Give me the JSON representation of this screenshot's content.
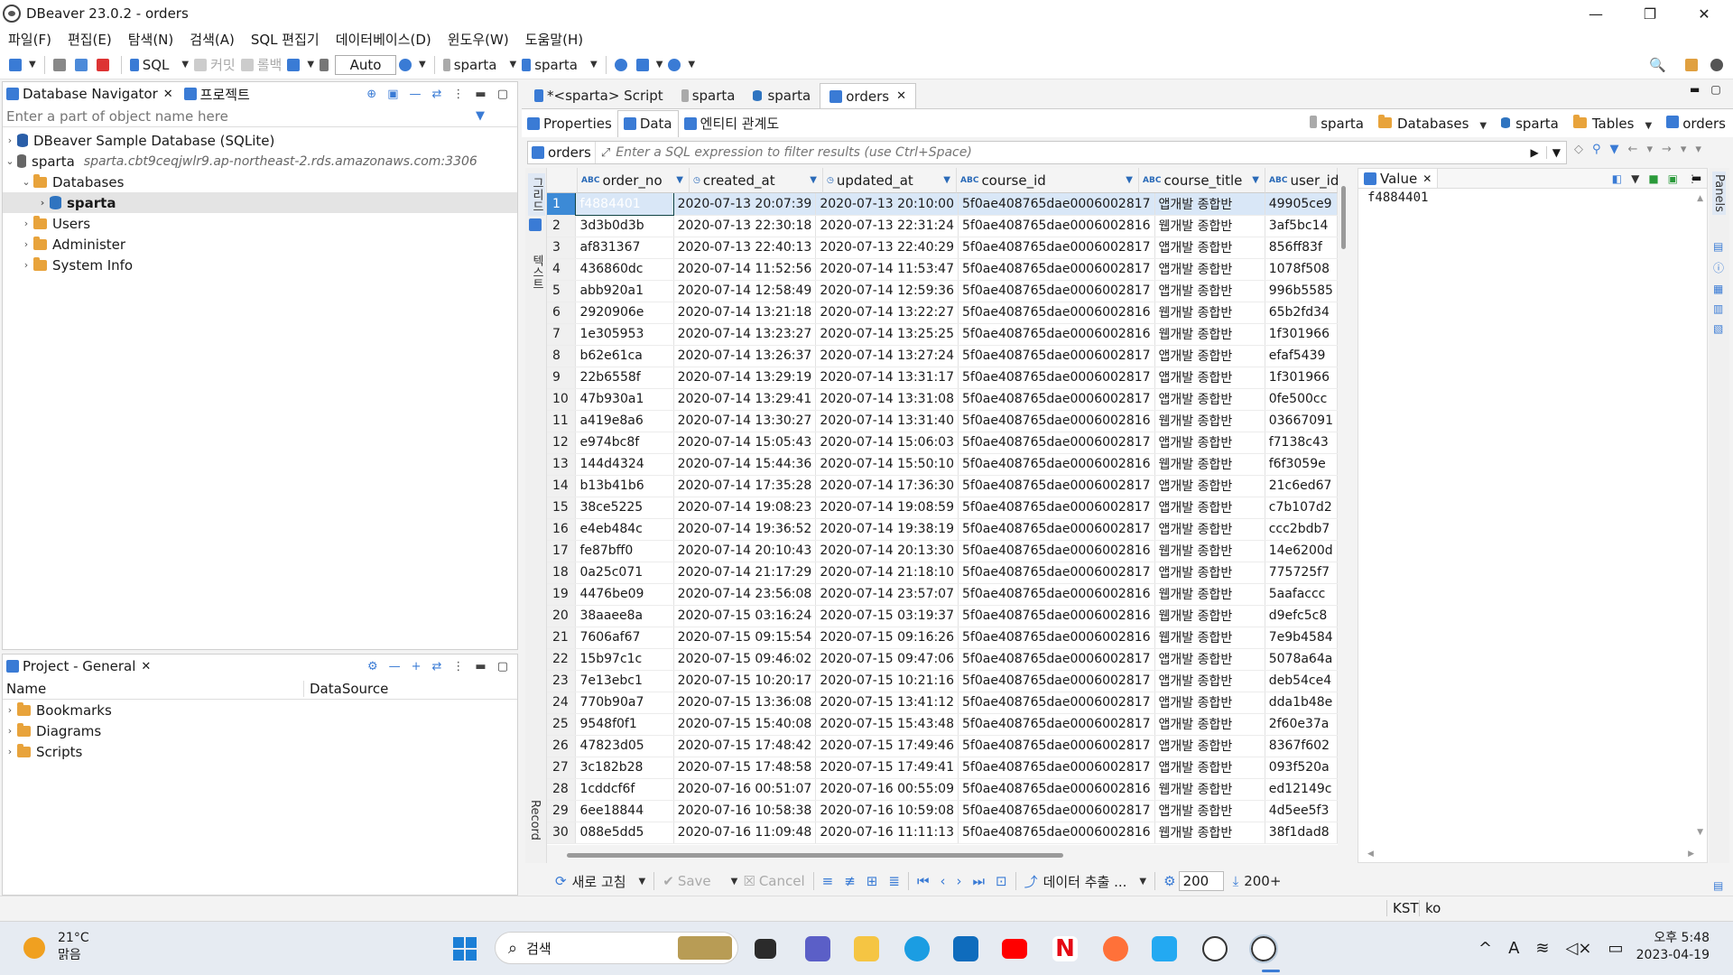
{
  "window": {
    "title": "DBeaver 23.0.2 - orders",
    "controls": [
      "—",
      "❐",
      "✕"
    ]
  },
  "menu": [
    "파일(F)",
    "편집(E)",
    "탐색(N)",
    "검색(A)",
    "SQL 편집기",
    "데이터베이스(D)",
    "윈도우(W)",
    "도움말(H)"
  ],
  "toolbar": {
    "sql": "SQL",
    "commit": "커밋",
    "rollback": "롤백",
    "mode": "Auto",
    "conn1": "sparta",
    "conn2": "sparta"
  },
  "navigator": {
    "tab1": "Database Navigator",
    "tab2": "프로젝트",
    "filter_placeholder": "Enter a part of object name here",
    "tree": [
      {
        "label": "DBeaver Sample Database (SQLite)",
        "sub": ""
      },
      {
        "label": "sparta",
        "sub": "sparta.cbt9ceqjwlr9.ap-northeast-2.rds.amazonaws.com:3306"
      },
      {
        "label": "Databases"
      },
      {
        "label": "sparta"
      },
      {
        "label": "Users"
      },
      {
        "label": "Administer"
      },
      {
        "label": "System Info"
      }
    ]
  },
  "project": {
    "tab": "Project - General",
    "col_name": "Name",
    "col_ds": "DataSource",
    "items": [
      "Bookmarks",
      "Diagrams",
      "Scripts"
    ]
  },
  "editor": {
    "tabs": [
      "*<sparta> Script",
      "sparta",
      "sparta",
      "orders"
    ],
    "subtabs": [
      "Properties",
      "Data",
      "엔티티 관계도"
    ],
    "breadcrumb": [
      "sparta",
      "Databases",
      "sparta",
      "Tables",
      "orders"
    ],
    "filter_label": "orders",
    "filter_placeholder": "Enter a SQL expression to filter results (use Ctrl+Space)",
    "side_labels": {
      "grid": "그리드",
      "text": "텍스트",
      "record": "Record"
    }
  },
  "columns": [
    "order_no",
    "created_at",
    "updated_at",
    "course_id",
    "course_title",
    "user_id"
  ],
  "rows": [
    [
      "1",
      "f4884401",
      "2020-07-13 20:07:39",
      "2020-07-13 20:10:00",
      "5f0ae408765dae0006002817",
      "앱개발 종합반",
      "49905ce9"
    ],
    [
      "2",
      "3d3b0d3b",
      "2020-07-13 22:30:18",
      "2020-07-13 22:31:24",
      "5f0ae408765dae0006002816",
      "웹개발 종합반",
      "3af5bc14"
    ],
    [
      "3",
      "af831367",
      "2020-07-13 22:40:13",
      "2020-07-13 22:40:29",
      "5f0ae408765dae0006002817",
      "앱개발 종합반",
      "856ff83f"
    ],
    [
      "4",
      "436860dc",
      "2020-07-14 11:52:56",
      "2020-07-14 11:53:47",
      "5f0ae408765dae0006002817",
      "앱개발 종합반",
      "1078f508"
    ],
    [
      "5",
      "abb920a1",
      "2020-07-14 12:58:49",
      "2020-07-14 12:59:36",
      "5f0ae408765dae0006002817",
      "앱개발 종합반",
      "996b5585"
    ],
    [
      "6",
      "2920906e",
      "2020-07-14 13:21:18",
      "2020-07-14 13:22:27",
      "5f0ae408765dae0006002816",
      "웹개발 종합반",
      "65b2fd34"
    ],
    [
      "7",
      "1e305953",
      "2020-07-14 13:23:27",
      "2020-07-14 13:25:25",
      "5f0ae408765dae0006002816",
      "웹개발 종합반",
      "1f301966"
    ],
    [
      "8",
      "b62e61ca",
      "2020-07-14 13:26:37",
      "2020-07-14 13:27:24",
      "5f0ae408765dae0006002817",
      "앱개발 종합반",
      "efaf5439"
    ],
    [
      "9",
      "22b6558f",
      "2020-07-14 13:29:19",
      "2020-07-14 13:31:17",
      "5f0ae408765dae0006002817",
      "앱개발 종합반",
      "1f301966"
    ],
    [
      "10",
      "47b930a1",
      "2020-07-14 13:29:41",
      "2020-07-14 13:31:08",
      "5f0ae408765dae0006002817",
      "앱개발 종합반",
      "0fe500cc"
    ],
    [
      "11",
      "a419e8a6",
      "2020-07-14 13:30:27",
      "2020-07-14 13:31:40",
      "5f0ae408765dae0006002816",
      "웹개발 종합반",
      "03667091"
    ],
    [
      "12",
      "e974bc8f",
      "2020-07-14 15:05:43",
      "2020-07-14 15:06:03",
      "5f0ae408765dae0006002817",
      "앱개발 종합반",
      "f7138c43"
    ],
    [
      "13",
      "144d4324",
      "2020-07-14 15:44:36",
      "2020-07-14 15:50:10",
      "5f0ae408765dae0006002816",
      "웹개발 종합반",
      "f6f3059e"
    ],
    [
      "14",
      "b13b41b6",
      "2020-07-14 17:35:28",
      "2020-07-14 17:36:30",
      "5f0ae408765dae0006002817",
      "앱개발 종합반",
      "21c6ed67"
    ],
    [
      "15",
      "38ce5225",
      "2020-07-14 19:08:23",
      "2020-07-14 19:08:59",
      "5f0ae408765dae0006002817",
      "앱개발 종합반",
      "c7b107d2"
    ],
    [
      "16",
      "e4eb484c",
      "2020-07-14 19:36:52",
      "2020-07-14 19:38:19",
      "5f0ae408765dae0006002817",
      "앱개발 종합반",
      "ccc2bdb7"
    ],
    [
      "17",
      "fe87bff0",
      "2020-07-14 20:10:43",
      "2020-07-14 20:13:30",
      "5f0ae408765dae0006002816",
      "웹개발 종합반",
      "14e6200d"
    ],
    [
      "18",
      "0a25c071",
      "2020-07-14 21:17:29",
      "2020-07-14 21:18:10",
      "5f0ae408765dae0006002817",
      "앱개발 종합반",
      "775725f7"
    ],
    [
      "19",
      "4476be09",
      "2020-07-14 23:56:08",
      "2020-07-14 23:57:07",
      "5f0ae408765dae0006002816",
      "웹개발 종합반",
      "5aafaccc"
    ],
    [
      "20",
      "38aaee8a",
      "2020-07-15 03:16:24",
      "2020-07-15 03:19:37",
      "5f0ae408765dae0006002816",
      "웹개발 종합반",
      "d9efc5c8"
    ],
    [
      "21",
      "7606af67",
      "2020-07-15 09:15:54",
      "2020-07-15 09:16:26",
      "5f0ae408765dae0006002816",
      "웹개발 종합반",
      "7e9b4584"
    ],
    [
      "22",
      "15b97c1c",
      "2020-07-15 09:46:02",
      "2020-07-15 09:47:06",
      "5f0ae408765dae0006002817",
      "앱개발 종합반",
      "5078a64a"
    ],
    [
      "23",
      "7e13ebc1",
      "2020-07-15 10:20:17",
      "2020-07-15 10:21:16",
      "5f0ae408765dae0006002817",
      "앱개발 종합반",
      "deb54ce4"
    ],
    [
      "24",
      "770b90a7",
      "2020-07-15 13:36:08",
      "2020-07-15 13:41:12",
      "5f0ae408765dae0006002817",
      "앱개발 종합반",
      "dda1b48e"
    ],
    [
      "25",
      "9548f0f1",
      "2020-07-15 15:40:08",
      "2020-07-15 15:43:48",
      "5f0ae408765dae0006002817",
      "앱개발 종합반",
      "2f60e37a"
    ],
    [
      "26",
      "47823d05",
      "2020-07-15 17:48:42",
      "2020-07-15 17:49:46",
      "5f0ae408765dae0006002817",
      "앱개발 종합반",
      "8367f602"
    ],
    [
      "27",
      "3c182b28",
      "2020-07-15 17:48:58",
      "2020-07-15 17:49:41",
      "5f0ae408765dae0006002817",
      "앱개발 종합반",
      "093f520a"
    ],
    [
      "28",
      "1cddcf6f",
      "2020-07-16 00:51:07",
      "2020-07-16 00:55:09",
      "5f0ae408765dae0006002816",
      "웹개발 종합반",
      "ed12149c"
    ],
    [
      "29",
      "6ee18844",
      "2020-07-16 10:58:38",
      "2020-07-16 10:59:08",
      "5f0ae408765dae0006002817",
      "앱개발 종합반",
      "4d5ee5f3"
    ],
    [
      "30",
      "088e5dd5",
      "2020-07-16 11:09:48",
      "2020-07-16 11:11:13",
      "5f0ae408765dae0006002816",
      "웹개발 종합반",
      "38f1dad8"
    ]
  ],
  "value_panel": {
    "tab": "Value",
    "content": "f4884401",
    "side": "Panels"
  },
  "bottom": {
    "refresh": "새로 고침",
    "save": "Save",
    "cancel": "Cancel",
    "export": "데이터 추출 ...",
    "fetch_size": "200",
    "fetched": "200+"
  },
  "status": {
    "tz": "KST",
    "locale": "ko"
  },
  "taskbar": {
    "weather_temp": "21°C",
    "weather_desc": "맑음",
    "search": "검색",
    "time": "오후 5:48",
    "date": "2023-04-19"
  }
}
